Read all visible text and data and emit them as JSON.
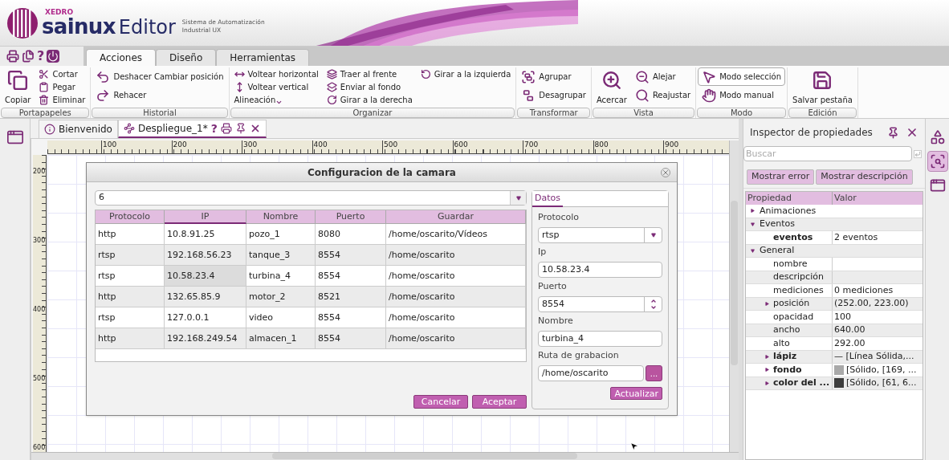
{
  "header": {
    "brand": "XEDRO",
    "product": "sainux",
    "product_suffix": "Editor",
    "tagline": [
      "Sistema de Automatización",
      "Industrial UX"
    ]
  },
  "quick_bar": {
    "help": "?"
  },
  "menu_tabs": [
    {
      "label": "Acciones",
      "selected": true
    },
    {
      "label": "Diseño",
      "selected": false
    },
    {
      "label": "Herramientas",
      "selected": false
    }
  ],
  "ribbon": [
    {
      "group": "Portapapeles",
      "columns": [
        [
          {
            "label": "Copiar",
            "kind": "large"
          }
        ],
        [
          {
            "label": "Cortar",
            "kind": "small"
          },
          {
            "label": "Pegar",
            "kind": "small"
          },
          {
            "label": "Eliminar",
            "kind": "small"
          }
        ]
      ]
    },
    {
      "group": "Historial",
      "columns": [
        [
          {
            "label": "Deshacer Cambiar posición",
            "kind": "medium"
          },
          {
            "label": "Rehacer",
            "kind": "medium"
          }
        ]
      ]
    },
    {
      "group": "Organizar",
      "columns": [
        [
          {
            "label": "Voltear horizontal",
            "kind": "small"
          },
          {
            "label": "Voltear vertical",
            "kind": "small"
          },
          {
            "label": "Alineación",
            "kind": "dropdown"
          }
        ],
        [
          {
            "label": "Traer al frente",
            "kind": "small"
          },
          {
            "label": "Enviar al fondo",
            "kind": "small"
          },
          {
            "label": "Girar a la derecha",
            "kind": "small"
          }
        ],
        [
          {
            "label": "Girar a la izquierda",
            "kind": "small"
          }
        ]
      ]
    },
    {
      "group": "Transformar",
      "columns": [
        [
          {
            "label": "Agrupar",
            "kind": "medium"
          },
          {
            "label": "Desagrupar",
            "kind": "medium"
          }
        ]
      ]
    },
    {
      "group": "Vista",
      "columns": [
        [
          {
            "label": "Acercar",
            "kind": "large"
          }
        ],
        [
          {
            "label": "Alejar",
            "kind": "medium"
          },
          {
            "label": "Reajustar",
            "kind": "medium"
          }
        ]
      ]
    },
    {
      "group": "Modo",
      "columns": [
        [
          {
            "label": "Modo selección",
            "kind": "medium",
            "selected": true
          },
          {
            "label": "Modo manual",
            "kind": "medium",
            "selected": false
          }
        ]
      ]
    },
    {
      "group": "Edición",
      "columns": [
        [
          {
            "label": "Salvar pestaña",
            "kind": "large"
          }
        ]
      ]
    }
  ],
  "doc_tabs": [
    {
      "label": "Bienvenido",
      "selected": false
    },
    {
      "label": "Despliegue_1*",
      "selected": true,
      "help": "?"
    }
  ],
  "ruler": {
    "x_labels": [
      "100",
      "200",
      "300",
      "400",
      "500",
      "600",
      "700",
      "800",
      "900"
    ],
    "y_labels": [
      "200",
      "300",
      "400",
      "500",
      "600"
    ]
  },
  "dialog": {
    "title": "Configuracion de la camara",
    "count": "6",
    "columns": [
      {
        "label": "Protocolo",
        "selected": false
      },
      {
        "label": "IP",
        "selected": true
      },
      {
        "label": "Nombre",
        "selected": false
      },
      {
        "label": "Puerto",
        "selected": false
      },
      {
        "label": "Guardar",
        "selected": false
      }
    ],
    "rows": [
      {
        "cells": [
          {
            "text": "http",
            "focused": false
          },
          {
            "text": "10.8.91.25",
            "focused": false
          },
          {
            "text": "pozo_1",
            "focused": false
          },
          {
            "text": "8080",
            "focused": false
          },
          {
            "text": "/home/oscarito/Vídeos",
            "focused": false
          }
        ]
      },
      {
        "cells": [
          {
            "text": "rtsp",
            "focused": false
          },
          {
            "text": "192.168.56.23",
            "focused": false
          },
          {
            "text": "tanque_3",
            "focused": false
          },
          {
            "text": "8554",
            "focused": false
          },
          {
            "text": "/home/oscarito",
            "focused": false
          }
        ]
      },
      {
        "cells": [
          {
            "text": "rtsp",
            "focused": false
          },
          {
            "text": "10.58.23.4",
            "focused": true
          },
          {
            "text": "turbina_4",
            "focused": false
          },
          {
            "text": "8554",
            "focused": false
          },
          {
            "text": "/home/oscarito",
            "focused": false
          }
        ]
      },
      {
        "cells": [
          {
            "text": "http",
            "focused": false
          },
          {
            "text": "132.65.85.9",
            "focused": false
          },
          {
            "text": "motor_2",
            "focused": false
          },
          {
            "text": "8521",
            "focused": false
          },
          {
            "text": "/home/oscarito",
            "focused": false
          }
        ]
      },
      {
        "cells": [
          {
            "text": "rtsp",
            "focused": false
          },
          {
            "text": "127.0.0.1",
            "focused": false
          },
          {
            "text": "video",
            "focused": false
          },
          {
            "text": "8554",
            "focused": false
          },
          {
            "text": "/home/oscarito",
            "focused": false
          }
        ]
      },
      {
        "cells": [
          {
            "text": "http",
            "focused": false
          },
          {
            "text": "192.168.249.54",
            "focused": false
          },
          {
            "text": "almacen_1",
            "focused": false
          },
          {
            "text": "8554",
            "focused": false
          },
          {
            "text": "/home/oscarito",
            "focused": false
          }
        ]
      }
    ],
    "buttons": [
      "Cancelar",
      "Aceptar"
    ],
    "panel": {
      "tab": "Datos",
      "fields": [
        {
          "label": "Protocolo",
          "kind": "select",
          "value": "rtsp"
        },
        {
          "label": "Ip",
          "kind": "text",
          "value": "10.58.23.4"
        },
        {
          "label": "Puerto",
          "kind": "spin",
          "value": "8554"
        },
        {
          "label": "Nombre",
          "kind": "text",
          "value": "turbina_4"
        },
        {
          "label": "Ruta de grabacion",
          "kind": "browse",
          "value": "/home/oscarito",
          "button": "..."
        }
      ],
      "update_button": "Actualizar"
    }
  },
  "inspector": {
    "title": "Inspector de propiedades",
    "search_placeholder": "Buscar",
    "buttons": [
      "Mostrar error",
      "Mostrar descripción"
    ],
    "columns": [
      "Propiedad",
      "Valor"
    ],
    "groups": [
      {
        "name": "Animaciones",
        "expanded": false
      },
      {
        "name": "Eventos",
        "expanded": true,
        "children": [
          {
            "name": "eventos",
            "value": "2 eventos",
            "bold": true,
            "kind": "leaf"
          }
        ]
      },
      {
        "name": "General",
        "expanded": true,
        "children": [
          {
            "name": "nombre",
            "bold": false,
            "kind": "leaf"
          },
          {
            "name": "descripción",
            "bold": false,
            "kind": "leaf"
          },
          {
            "name": "mediciones",
            "value": "0 mediciones",
            "bold": false,
            "kind": "leaf"
          },
          {
            "name": "posición",
            "value": "(252.00, 223.00)",
            "bold": false,
            "kind": "node",
            "expanded": false
          },
          {
            "name": "opacidad",
            "value": "100",
            "bold": false,
            "kind": "leaf"
          },
          {
            "name": "ancho",
            "value": "640.00",
            "bold": false,
            "kind": "leaf"
          },
          {
            "name": "alto",
            "value": "292.00",
            "bold": false,
            "kind": "leaf"
          },
          {
            "name": "lápiz",
            "value": "— [Línea Sólida,...",
            "bold": true,
            "kind": "node",
            "expanded": false
          },
          {
            "name": "fondo",
            "value": "[Sólido, [169, ...",
            "bold": true,
            "kind": "node",
            "expanded": false,
            "color": "#a9a9a9"
          },
          {
            "name": "color del ...",
            "value": "[Sólido, [61, 6...",
            "bold": true,
            "kind": "node",
            "expanded": false,
            "color": "#3d3d3d"
          }
        ]
      }
    ]
  },
  "side_tools": [
    {
      "selected": false
    },
    {
      "selected": true
    },
    {
      "selected": false
    }
  ]
}
